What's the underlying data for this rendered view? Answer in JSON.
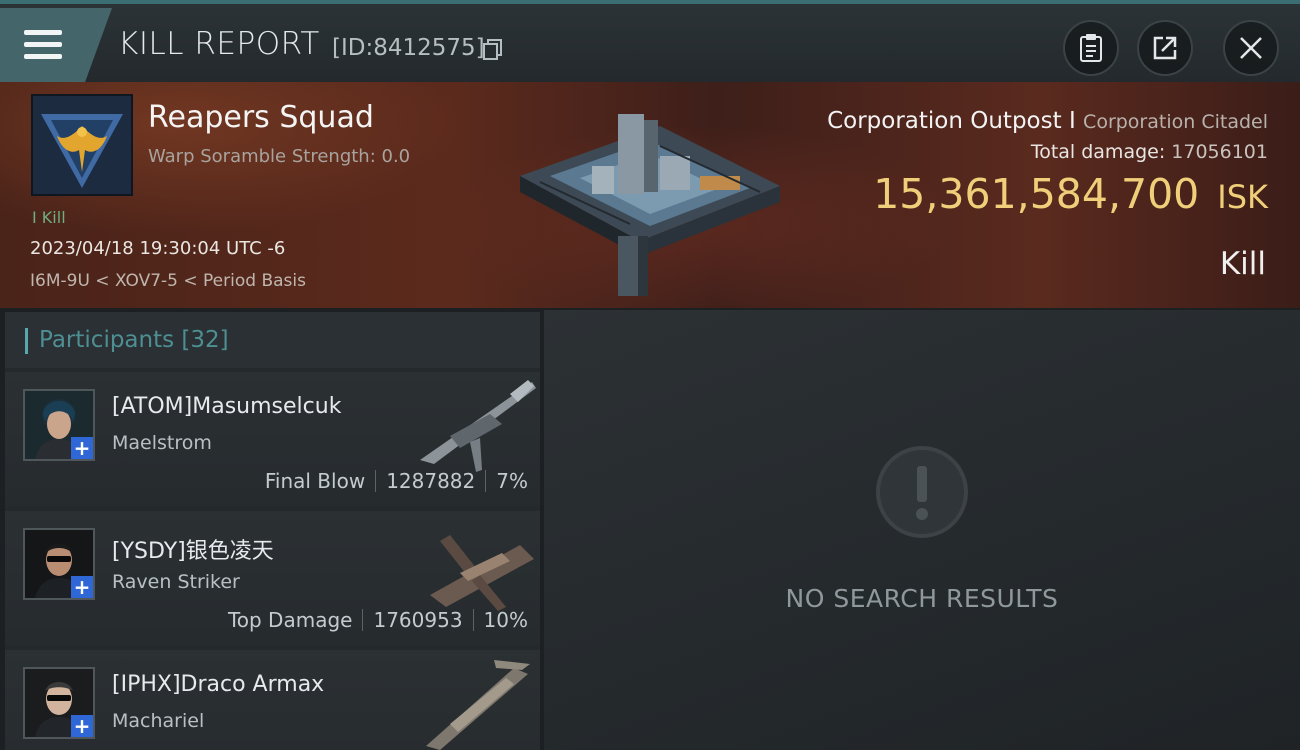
{
  "header": {
    "title": "KILL REPORT",
    "report_id": "[ID:8412575]",
    "icons": [
      "menu-icon",
      "copy-icon",
      "clipboard-icon",
      "share-icon",
      "close-icon"
    ]
  },
  "victim": {
    "name": "Reapers Squad",
    "warp_scramble": "Warp Soramble Strength: 0.0",
    "kill_tag": "I Kill",
    "datetime": "2023/04/18 19:30:04 UTC -6",
    "location": "I6M-9U < XOV7-5 < Period Basis",
    "target_name": "Corporation Outpost I",
    "target_type": "Corporation Citadel",
    "total_damage_label": "Total damage:",
    "total_damage": "17056101",
    "isk_value": "15,361,584,700",
    "isk_unit": "ISK",
    "result": "Kill",
    "colors": {
      "isk": "#f0cf7a",
      "kill_tag": "#6fae7d"
    }
  },
  "participants": {
    "label": "Participants",
    "count": "[32]",
    "items": [
      {
        "name": "[ATOM]Masumselcuk",
        "ship": "Maelstrom",
        "tag": "Final Blow",
        "damage": "1287882",
        "percent": "7%"
      },
      {
        "name": "[YSDY]银色凌天",
        "ship": "Raven Striker",
        "tag": "Top Damage",
        "damage": "1760953",
        "percent": "10%"
      },
      {
        "name": "[IPHX]Draco Armax",
        "ship": "Machariel",
        "tag": "",
        "damage": "",
        "percent": ""
      }
    ]
  },
  "empty_state": {
    "text": "NO SEARCH RESULTS",
    "icon": "exclamation-icon"
  }
}
